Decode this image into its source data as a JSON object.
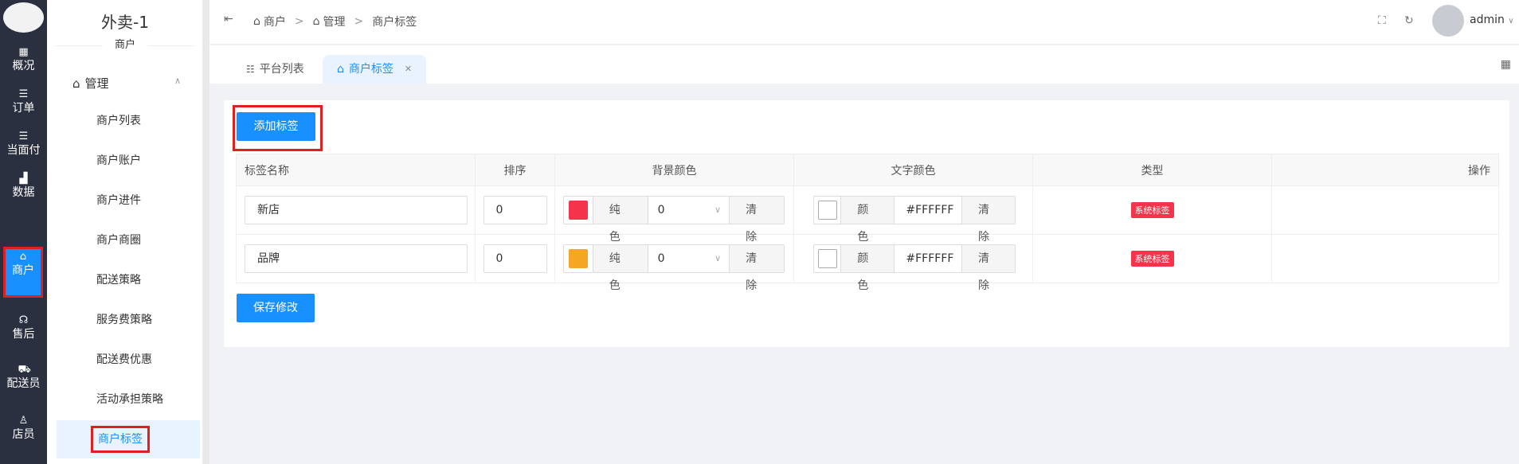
{
  "rail": {
    "items": [
      {
        "label": "概况",
        "icon": "dashboard-icon"
      },
      {
        "label": "订单",
        "icon": "list-icon"
      },
      {
        "label": "当面付",
        "icon": "list-icon"
      },
      {
        "label": "数据",
        "icon": "bar-chart-icon"
      },
      {
        "label": "商户",
        "icon": "store-icon"
      },
      {
        "label": "售后",
        "icon": "headset-icon"
      },
      {
        "label": "配送员",
        "icon": "delivery-icon"
      },
      {
        "label": "店员",
        "icon": "staff-icon"
      }
    ]
  },
  "sidebar": {
    "title": "外卖-1",
    "subtitle": "商户",
    "group_label": "管理",
    "items": [
      {
        "label": "商户列表"
      },
      {
        "label": "商户账户"
      },
      {
        "label": "商户进件"
      },
      {
        "label": "商户商圈"
      },
      {
        "label": "配送策略"
      },
      {
        "label": "服务费策略"
      },
      {
        "label": "配送费优惠"
      },
      {
        "label": "活动承担策略"
      },
      {
        "label": "商户标签"
      }
    ]
  },
  "header": {
    "breadcrumb": [
      "商户",
      "管理",
      "商户标签"
    ],
    "username": "admin"
  },
  "tabs": [
    {
      "label": "平台列表"
    },
    {
      "label": "商户标签"
    }
  ],
  "toolbar": {
    "add_label": "添加标签",
    "save_label": "保存修改"
  },
  "table": {
    "headers": [
      "标签名称",
      "排序",
      "背景颜色",
      "文字颜色",
      "类型",
      "操作"
    ],
    "rows": [
      {
        "name": "新店",
        "sort": "0",
        "bg_mode": "纯色",
        "bg_select": "0",
        "bg_clear": "清除",
        "bg_color": "#f5334a",
        "text_mode": "颜色",
        "text_color": "#FFFFFF",
        "text_clear": "清除",
        "type": "系统标签"
      },
      {
        "name": "品牌",
        "sort": "0",
        "bg_mode": "纯色",
        "bg_select": "0",
        "bg_clear": "清除",
        "bg_color": "#f5a623",
        "text_mode": "颜色",
        "text_color": "#FFFFFF",
        "text_clear": "清除",
        "type": "系统标签"
      }
    ]
  },
  "colors": {
    "accent": "#1890ff",
    "rail_bg": "#2b3040",
    "badge": "#f5334a",
    "highlight_frame": "#e02020"
  }
}
